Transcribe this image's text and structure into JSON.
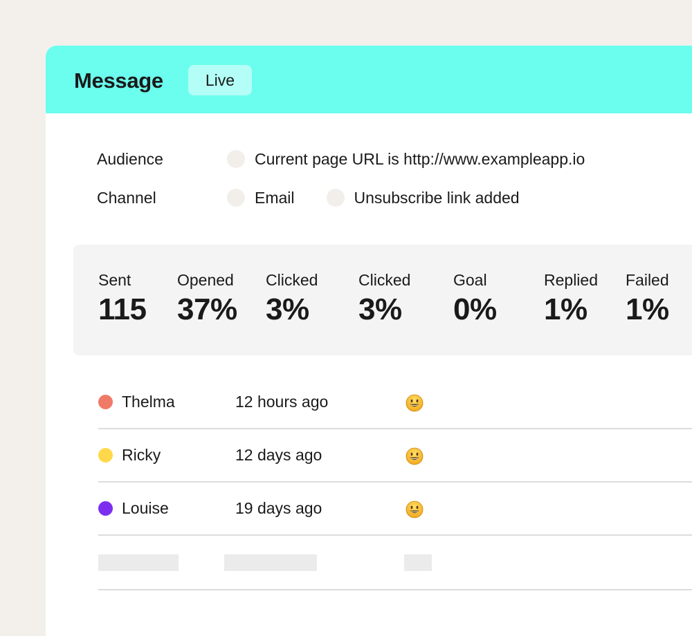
{
  "header": {
    "title": "Message",
    "status": "Live",
    "accent_color": "#6bfdee"
  },
  "audience": {
    "label": "Audience",
    "rule": "Current page URL is http://www.exampleapp.io"
  },
  "channel": {
    "label": "Channel",
    "type": "Email",
    "option": "Unsubscribe link added"
  },
  "stats": [
    {
      "label": "Sent",
      "value": "115"
    },
    {
      "label": "Opened",
      "value": "37%"
    },
    {
      "label": "Clicked",
      "value": "3%"
    },
    {
      "label": "Clicked",
      "value": "3%"
    },
    {
      "label": "Goal",
      "value": "0%"
    },
    {
      "label": "Replied",
      "value": "1%"
    },
    {
      "label": "Failed",
      "value": "1%"
    }
  ],
  "recipients": [
    {
      "name": "Thelma",
      "time": "12 hours ago",
      "color": "#f07a68",
      "reaction": "smiley-icon"
    },
    {
      "name": "Ricky",
      "time": "12 days ago",
      "color": "#ffd84a",
      "reaction": "smiley-icon"
    },
    {
      "name": "Louise",
      "time": "19 days ago",
      "color": "#7d2ff0",
      "reaction": "smiley-icon"
    }
  ]
}
